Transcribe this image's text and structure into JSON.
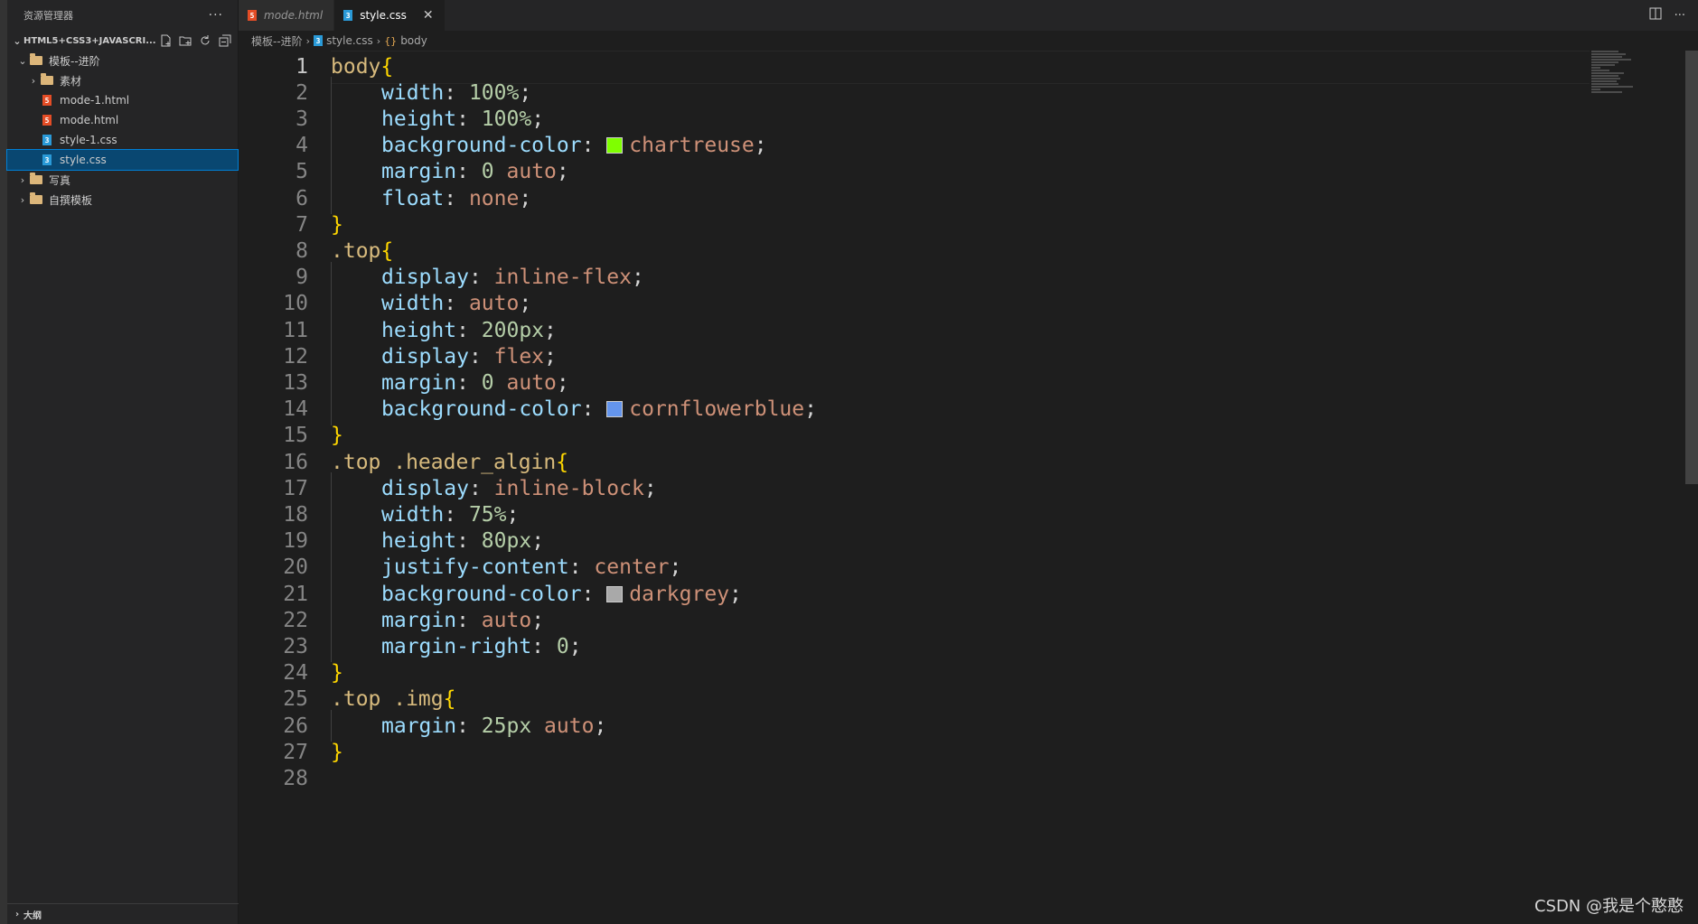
{
  "sidebar": {
    "title": "资源管理器",
    "more": "···",
    "workspace": "HTML5+CSS3+JAVASCRI...",
    "tree": [
      {
        "label": "模板--进阶",
        "type": "folder",
        "depth": 1,
        "expanded": true
      },
      {
        "label": "素材",
        "type": "folder",
        "depth": 2,
        "expanded": false
      },
      {
        "label": "mode-1.html",
        "type": "html",
        "depth": 2
      },
      {
        "label": "mode.html",
        "type": "html",
        "depth": 2
      },
      {
        "label": "style-1.css",
        "type": "css",
        "depth": 2
      },
      {
        "label": "style.css",
        "type": "css",
        "depth": 2,
        "selected": true
      },
      {
        "label": "写真",
        "type": "folder",
        "depth": 1,
        "expanded": false
      },
      {
        "label": "自撰模板",
        "type": "folder",
        "depth": 1,
        "expanded": false
      }
    ],
    "outline": "大纲"
  },
  "tabs": [
    {
      "label": "mode.html",
      "type": "html",
      "active": false,
      "italic": true
    },
    {
      "label": "style.css",
      "type": "css",
      "active": true,
      "close": "✕"
    }
  ],
  "breadcrumb": {
    "folder": "模板--进阶",
    "file": "style.css",
    "symbol": "body"
  },
  "code_lines": [
    [
      [
        "sel",
        "body"
      ],
      [
        "br",
        "{"
      ]
    ],
    [
      [
        "i",
        ""
      ],
      [
        "prop",
        "width"
      ],
      [
        "punc",
        ": "
      ],
      [
        "num",
        "100%"
      ],
      [
        "punc",
        ";"
      ]
    ],
    [
      [
        "i",
        ""
      ],
      [
        "prop",
        "height"
      ],
      [
        "punc",
        ": "
      ],
      [
        "num",
        "100%"
      ],
      [
        "punc",
        ";"
      ]
    ],
    [
      [
        "i",
        ""
      ],
      [
        "prop",
        "background-color"
      ],
      [
        "punc",
        ": "
      ],
      [
        "sw",
        "#7fff00"
      ],
      [
        "val",
        "chartreuse"
      ],
      [
        "punc",
        ";"
      ]
    ],
    [
      [
        "i",
        ""
      ],
      [
        "prop",
        "margin"
      ],
      [
        "punc",
        ": "
      ],
      [
        "num",
        "0"
      ],
      [
        "punc",
        " "
      ],
      [
        "val",
        "auto"
      ],
      [
        "punc",
        ";"
      ]
    ],
    [
      [
        "i",
        ""
      ],
      [
        "prop",
        "float"
      ],
      [
        "punc",
        ": "
      ],
      [
        "val",
        "none"
      ],
      [
        "punc",
        ";"
      ]
    ],
    [
      [
        "br",
        "}"
      ]
    ],
    [
      [
        "sel",
        ".top"
      ],
      [
        "br",
        "{"
      ]
    ],
    [
      [
        "i",
        ""
      ],
      [
        "prop",
        "display"
      ],
      [
        "punc",
        ": "
      ],
      [
        "val",
        "inline-flex"
      ],
      [
        "punc",
        ";"
      ]
    ],
    [
      [
        "i",
        ""
      ],
      [
        "prop",
        "width"
      ],
      [
        "punc",
        ": "
      ],
      [
        "val",
        "auto"
      ],
      [
        "punc",
        ";"
      ]
    ],
    [
      [
        "i",
        ""
      ],
      [
        "prop",
        "height"
      ],
      [
        "punc",
        ": "
      ],
      [
        "num",
        "200px"
      ],
      [
        "punc",
        ";"
      ]
    ],
    [
      [
        "i",
        ""
      ],
      [
        "prop",
        "display"
      ],
      [
        "punc",
        ": "
      ],
      [
        "val",
        "flex"
      ],
      [
        "punc",
        ";"
      ]
    ],
    [
      [
        "i",
        ""
      ],
      [
        "prop",
        "margin"
      ],
      [
        "punc",
        ": "
      ],
      [
        "num",
        "0"
      ],
      [
        "punc",
        " "
      ],
      [
        "val",
        "auto"
      ],
      [
        "punc",
        ";"
      ]
    ],
    [
      [
        "i",
        ""
      ],
      [
        "prop",
        "background-color"
      ],
      [
        "punc",
        ": "
      ],
      [
        "sw",
        "#6495ed"
      ],
      [
        "val",
        "cornflowerblue"
      ],
      [
        "punc",
        ";"
      ]
    ],
    [
      [
        "br",
        "}"
      ]
    ],
    [
      [
        "sel",
        ".top .header_algin"
      ],
      [
        "br",
        "{"
      ]
    ],
    [
      [
        "i",
        ""
      ],
      [
        "prop",
        "display"
      ],
      [
        "punc",
        ": "
      ],
      [
        "val",
        "inline-block"
      ],
      [
        "punc",
        ";"
      ]
    ],
    [
      [
        "i",
        ""
      ],
      [
        "prop",
        "width"
      ],
      [
        "punc",
        ": "
      ],
      [
        "num",
        "75%"
      ],
      [
        "punc",
        ";"
      ]
    ],
    [
      [
        "i",
        ""
      ],
      [
        "prop",
        "height"
      ],
      [
        "punc",
        ": "
      ],
      [
        "num",
        "80px"
      ],
      [
        "punc",
        ";"
      ]
    ],
    [
      [
        "i",
        ""
      ],
      [
        "prop",
        "justify-content"
      ],
      [
        "punc",
        ": "
      ],
      [
        "val",
        "center"
      ],
      [
        "punc",
        ";"
      ]
    ],
    [
      [
        "i",
        ""
      ],
      [
        "prop",
        "background-color"
      ],
      [
        "punc",
        ": "
      ],
      [
        "sw",
        "#a9a9a9"
      ],
      [
        "val",
        "darkgrey"
      ],
      [
        "punc",
        ";"
      ]
    ],
    [
      [
        "i",
        ""
      ],
      [
        "prop",
        "margin"
      ],
      [
        "punc",
        ": "
      ],
      [
        "val",
        "auto"
      ],
      [
        "punc",
        ";"
      ]
    ],
    [
      [
        "i",
        ""
      ],
      [
        "prop",
        "margin-right"
      ],
      [
        "punc",
        ": "
      ],
      [
        "num",
        "0"
      ],
      [
        "punc",
        ";"
      ]
    ],
    [
      [
        "br",
        "}"
      ]
    ],
    [
      [
        "sel",
        ".top .img"
      ],
      [
        "br",
        "{"
      ]
    ],
    [
      [
        "i",
        ""
      ],
      [
        "prop",
        "margin"
      ],
      [
        "punc",
        ": "
      ],
      [
        "num",
        "25px"
      ],
      [
        "punc",
        " "
      ],
      [
        "val",
        "auto"
      ],
      [
        "punc",
        ";"
      ]
    ],
    [
      [
        "br",
        "}"
      ]
    ],
    []
  ],
  "watermark": "CSDN @我是个憨憨"
}
